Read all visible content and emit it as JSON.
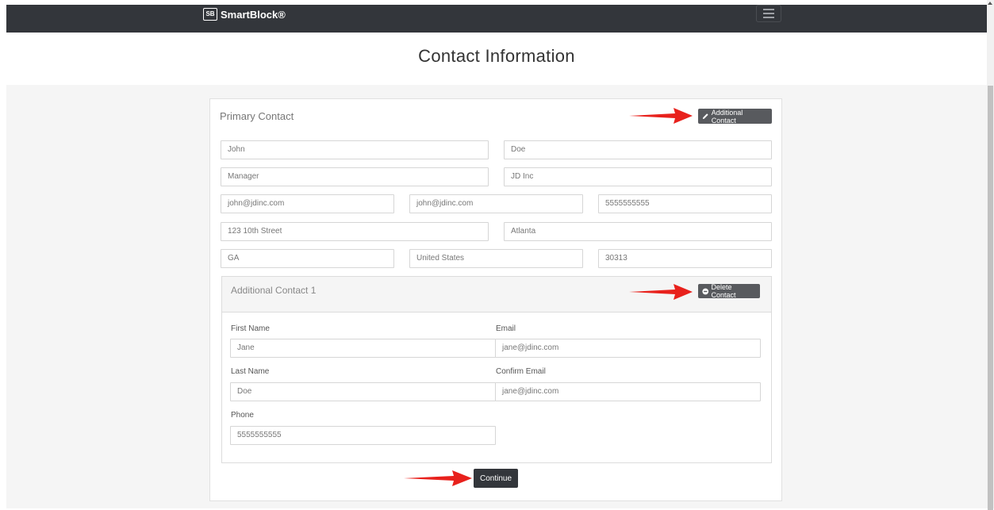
{
  "navbar": {
    "brand_logo": "SB",
    "brand_name": "SmartBlock®"
  },
  "page": {
    "title": "Contact Information"
  },
  "primary": {
    "title": "Primary Contact",
    "add_button": "Additional Contact",
    "first_name": "John",
    "last_name": "Doe",
    "job_title": "Manager",
    "company": "JD Inc",
    "email": "john@jdinc.com",
    "confirm_email": "john@jdinc.com",
    "phone": "5555555555",
    "address": "123 10th Street",
    "city": "Atlanta",
    "state": "GA",
    "country": "United States",
    "zip": "30313"
  },
  "additional": {
    "title": "Additional Contact 1",
    "delete_button": "Delete Contact",
    "first_name_label": "First Name",
    "first_name": "Jane",
    "email_label": "Email",
    "email": "jane@jdinc.com",
    "last_name_label": "Last Name",
    "last_name": "Doe",
    "confirm_email_label": "Confirm Email",
    "confirm_email": "jane@jdinc.com",
    "phone_label": "Phone",
    "phone": "5555555555"
  },
  "actions": {
    "continue": "Continue"
  },
  "colors": {
    "navbar": "#33363b",
    "button": "#585a5e",
    "arrow": "#e8211c"
  }
}
